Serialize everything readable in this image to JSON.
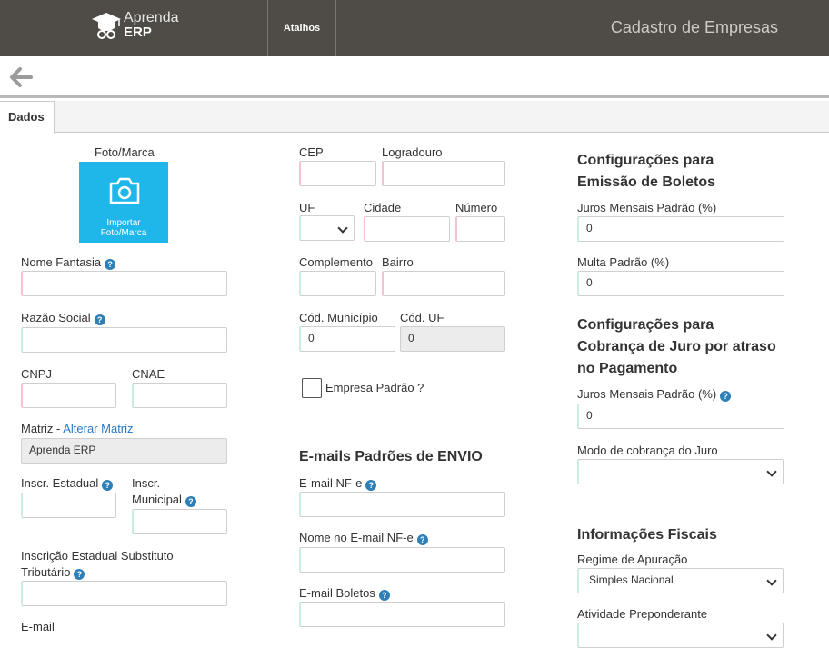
{
  "header": {
    "logo_line1": "Aprenda",
    "logo_line2": "ERP",
    "shortcuts": "Atalhos",
    "page_title": "Cadastro de Empresas"
  },
  "tabs": {
    "dados": "Dados"
  },
  "left": {
    "photo_label": "Foto/Marca",
    "photo_import_l1": "Importar",
    "photo_import_l2": "Foto/Marca",
    "nome_fantasia": "Nome Fantasia",
    "razao_social": "Razão Social",
    "cnpj": "CNPJ",
    "cnae": "CNAE",
    "matriz": "Matriz - ",
    "alterar_matriz": "Alterar Matriz",
    "matriz_value": "Aprenda ERP",
    "inscr_estadual": "Inscr. Estadual",
    "inscr_municipal": "Inscr. Municipal",
    "inscr_st": "Inscrição Estadual Substituto Tributário",
    "email": "E-mail"
  },
  "middle": {
    "cep": "CEP",
    "logradouro": "Logradouro",
    "uf": "UF",
    "cidade": "Cidade",
    "numero": "Número",
    "complemento": "Complemento",
    "bairro": "Bairro",
    "cod_municipio": "Cód. Município",
    "cod_municipio_value": "0",
    "cod_uf": "Cód. UF",
    "cod_uf_value": "0",
    "empresa_padrao": "Empresa Padrão ?",
    "emails_title": "E-mails Padrões de ENVIO",
    "email_nfe": "E-mail NF-e",
    "nome_email_nfe": "Nome no E-mail NF-e",
    "email_boletos": "E-mail Boletos"
  },
  "right": {
    "boletos_title": "Configurações para Emissão de Boletos",
    "juros_mensais": "Juros Mensais Padrão (%)",
    "juros_mensais_value": "0",
    "multa": "Multa Padrão (%)",
    "multa_value": "0",
    "cobranca_title": "Configurações para Cobrança de Juro por atraso no Pagamento",
    "juros_mensais2": "Juros Mensais Padrão (%)",
    "juros_mensais2_value": "0",
    "modo_cobranca": "Modo de cobrança do Juro",
    "fiscais_title": "Informações Fiscais",
    "regime": "Regime de Apuração",
    "regime_value": "Simples Nacional",
    "atividade": "Atividade Preponderante"
  },
  "colors": {
    "header_bg": "#4f4b46",
    "photo_bg": "#1fb6ea",
    "help_icon": "#2d7fb8",
    "link": "#2a79c4"
  }
}
